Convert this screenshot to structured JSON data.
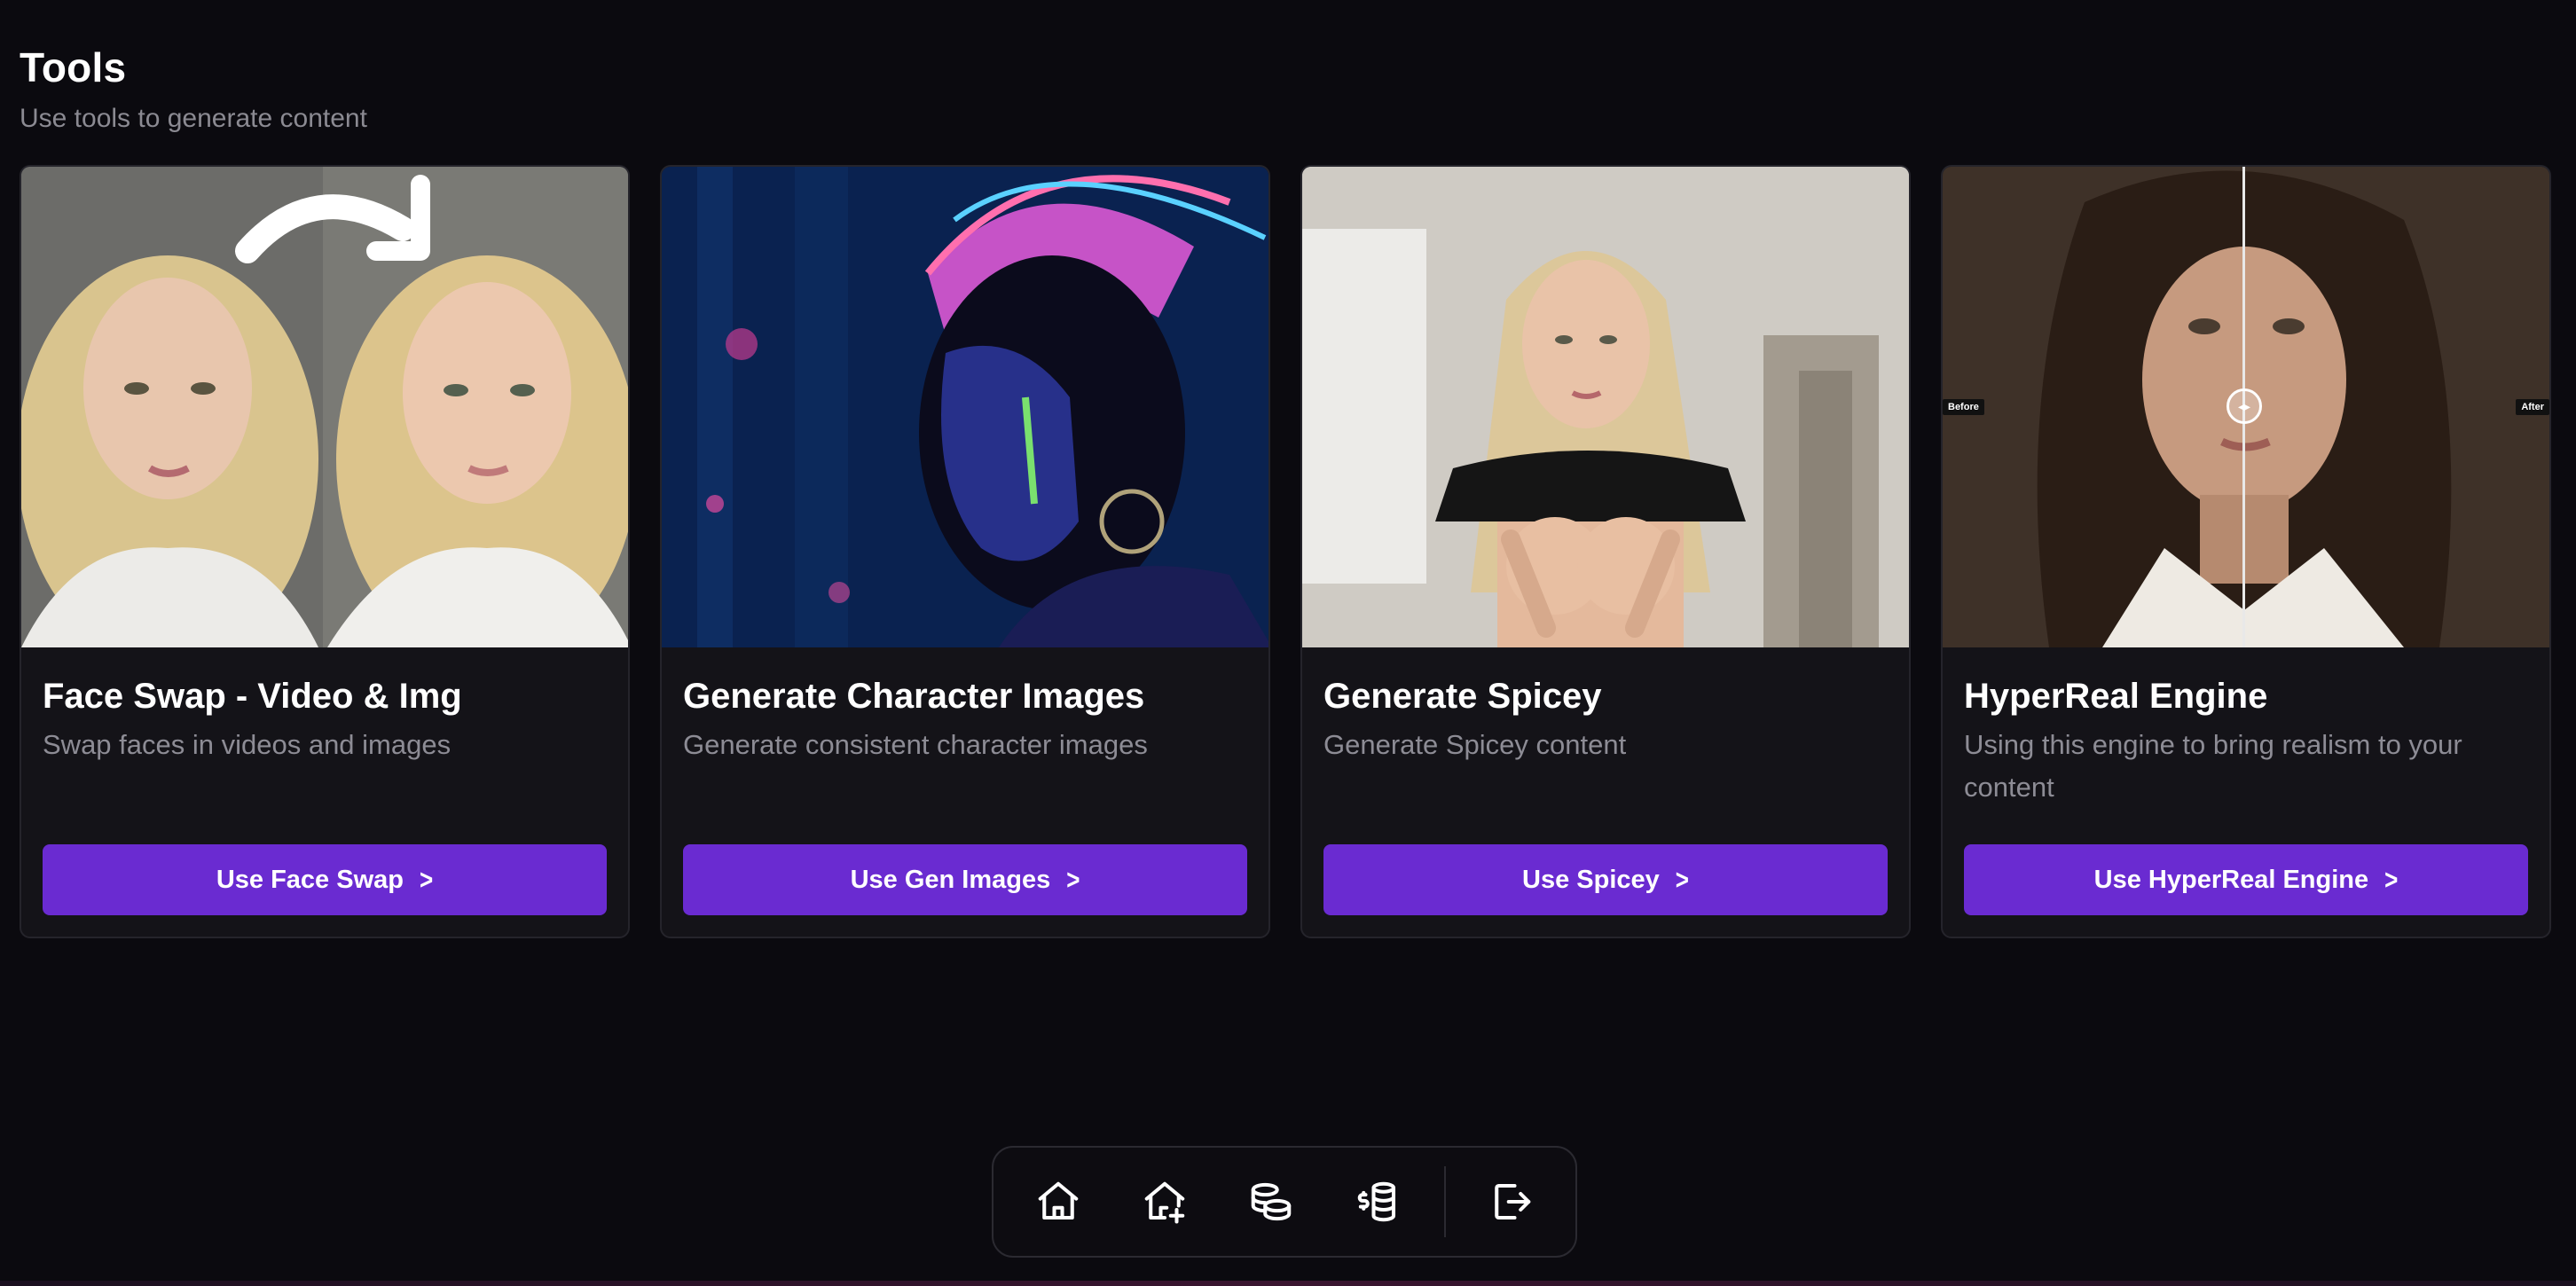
{
  "header": {
    "title": "Tools",
    "subtitle": "Use tools to generate content"
  },
  "cards": [
    {
      "title": "Face Swap - Video & Img",
      "description": "Swap faces in videos and images",
      "button_label": "Use Face Swap",
      "image": "face-swap-preview"
    },
    {
      "title": "Generate Character Images",
      "description": "Generate consistent character images",
      "button_label": "Use Gen Images",
      "image": "character-portrait-preview"
    },
    {
      "title": "Generate Spicey",
      "description": "Generate Spicey content",
      "button_label": "Use Spicey",
      "image": "spicey-preview"
    },
    {
      "title": "HyperReal Engine",
      "description": "Using this engine to bring realism to your content",
      "button_label": "Use HyperReal Engine",
      "image": "before-after-comparison",
      "before_label": "Before",
      "after_label": "After"
    }
  ],
  "dock": {
    "icons": [
      "home-icon",
      "home-add-icon",
      "coins-stack-icon",
      "dollar-coins-icon",
      "logout-icon"
    ]
  },
  "colors": {
    "background": "#0b0a0f",
    "card": "#141318",
    "accent": "#6a2bd1",
    "muted_text": "#8d8c95"
  }
}
